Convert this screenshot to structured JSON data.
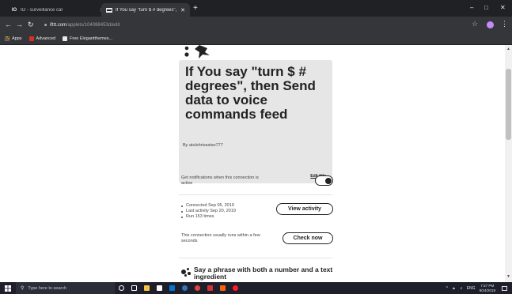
{
  "browser": {
    "tabs": [
      {
        "title": "IO - surveillance car",
        "active": false
      },
      {
        "title": "If You say \"turn $ # degrees\", th…",
        "active": true
      }
    ],
    "new_tab": "+",
    "window_controls": [
      "–",
      "□",
      "✕"
    ],
    "tab_close": "✕",
    "nav": {
      "back": "←",
      "forward": "→",
      "reload": "↻"
    },
    "url": {
      "host": "ifttt.com",
      "path": "/applets/104088453d/edit"
    },
    "bookmarks": [
      "Apps",
      "Advanced",
      "Free Elegantthemes..."
    ]
  },
  "applet": {
    "title": "If You say \"turn $ # degrees\", then Send data to voice commands feed",
    "edit_title": "Edit title",
    "byline": "By atulshrivastav777",
    "notifications_text": "Get notifications when this connection is active",
    "notifications_on": true,
    "stats": [
      "Connected Sep 05, 2019",
      "Last activity Sep 20, 2019",
      "Run 153 times"
    ],
    "view_activity": "View activity",
    "runs_text": "This connection usually runs within a few seconds",
    "check_now": "Check now",
    "trigger_text": "Say a phrase with both a number and a text ingredient"
  },
  "taskbar": {
    "search_placeholder": "Type here to search",
    "tray_lang": "ENG",
    "time": "7:37 PM",
    "date": "9/24/2019"
  },
  "colors": {
    "chrome_dark": "#202124",
    "chrome_toolbar": "#35363a",
    "title_card_bg": "#e6e6e6",
    "text_dark": "#222222",
    "taskbar_bg": "#1f1f2b"
  }
}
